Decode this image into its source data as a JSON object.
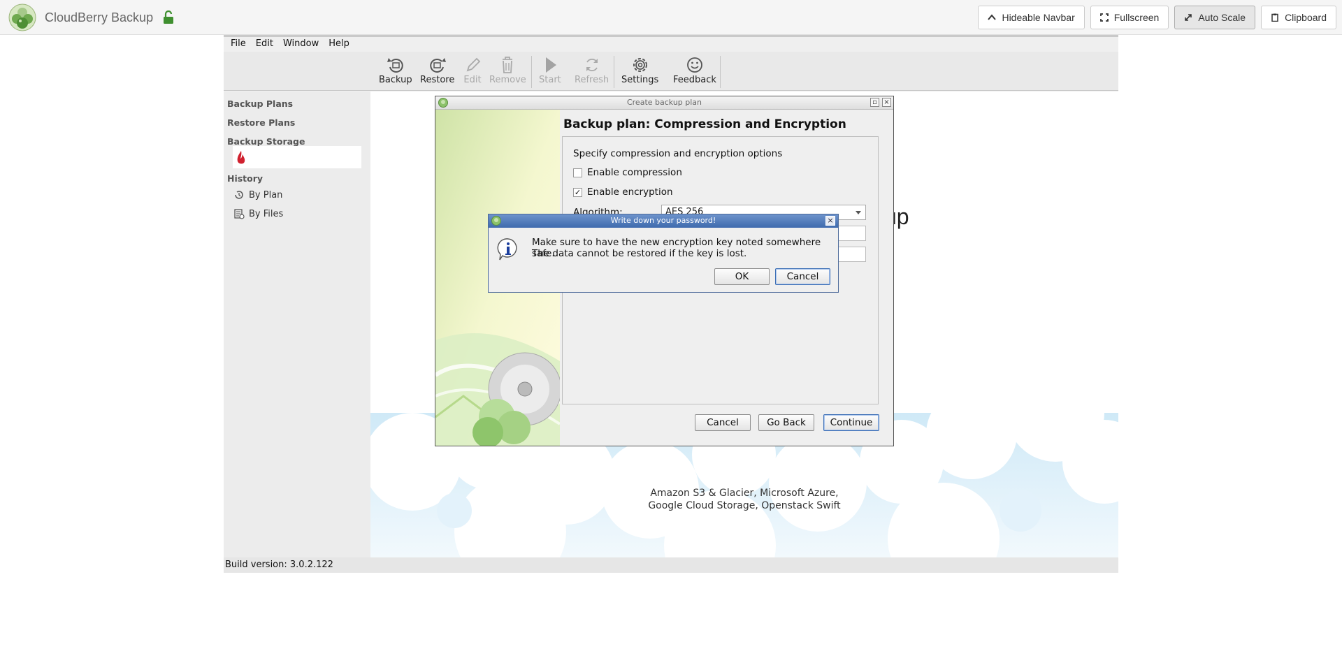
{
  "navbar": {
    "title": "CloudBerry Backup",
    "buttons": {
      "hideable_navbar": "Hideable Navbar",
      "fullscreen": "Fullscreen",
      "auto_scale": "Auto Scale",
      "clipboard": "Clipboard"
    }
  },
  "menu": [
    "File",
    "Edit",
    "Window",
    "Help"
  ],
  "toolbar": {
    "backup": "Backup",
    "restore": "Restore",
    "edit": "Edit",
    "remove": "Remove",
    "start": "Start",
    "refresh": "Refresh",
    "settings": "Settings",
    "feedback": "Feedback"
  },
  "sidebar": {
    "backup_plans": "Backup Plans",
    "restore_plans": "Restore Plans",
    "backup_storage": "Backup Storage",
    "history": "History",
    "by_plan": "By Plan",
    "by_files": "By Files"
  },
  "content": {
    "heading_fragment": "up",
    "caption_line1": "Amazon S3 & Glacier, Microsoft Azure,",
    "caption_line2": "Google Cloud Storage, Openstack Swift"
  },
  "status": {
    "build": "Build version: 3.0.2.122"
  },
  "wizard": {
    "window_title": "Create backup plan",
    "heading": "Backup plan: Compression and Encryption",
    "intro": "Specify compression and encryption options",
    "enable_compression": "Enable compression",
    "compression_checked": false,
    "enable_encryption": "Enable encryption",
    "encryption_checked": true,
    "algorithm_label": "Algorithm:",
    "algorithm_value": "AES 256",
    "cancel": "Cancel",
    "go_back": "Go Back",
    "continue": "Continue"
  },
  "dialog": {
    "title": "Write down your password!",
    "line1": "Make sure to have the new encryption key noted somewhere safe.",
    "line2": "The data cannot be restored if the key is lost.",
    "ok": "OK",
    "cancel": "Cancel"
  }
}
